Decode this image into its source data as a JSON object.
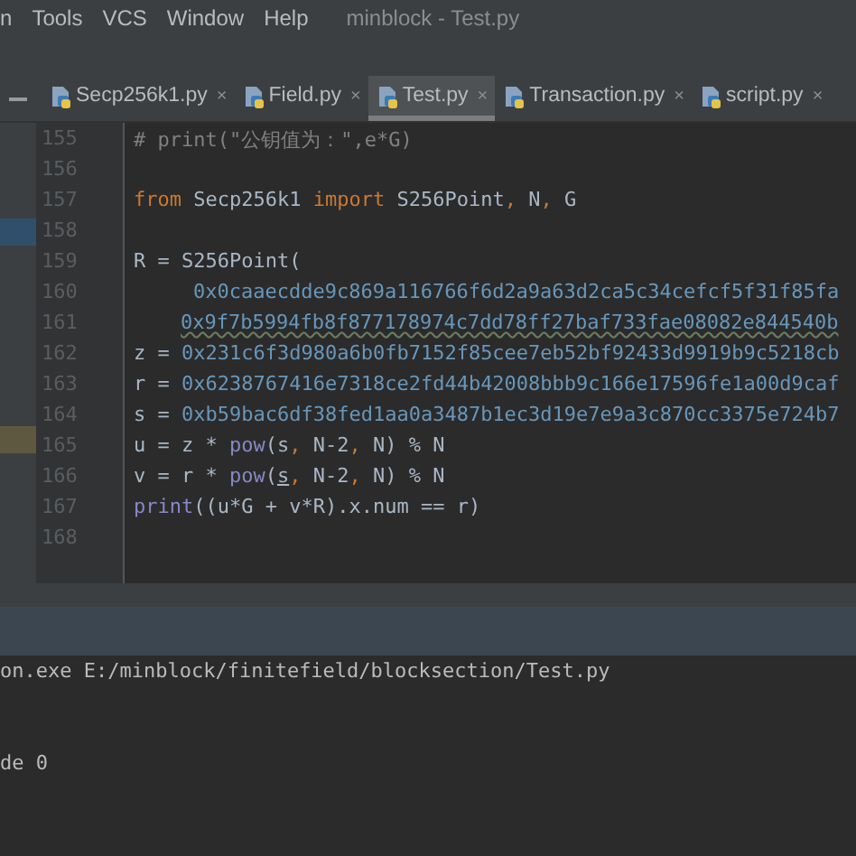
{
  "menu_bar": {
    "items": [
      "n",
      "Tools",
      "VCS",
      "Window",
      "Help"
    ],
    "title": "minblock - Test.py"
  },
  "tabs": [
    {
      "label": "Secp256k1.py",
      "close": "×",
      "selected": false
    },
    {
      "label": "Field.py",
      "close": "×",
      "selected": false
    },
    {
      "label": "Test.py",
      "close": "×",
      "selected": true
    },
    {
      "label": "Transaction.py",
      "close": "×",
      "selected": false
    },
    {
      "label": "script.py",
      "close": "×",
      "selected": false
    }
  ],
  "editor": {
    "lines": [
      {
        "number": "155",
        "tokens": [
          {
            "kind": "comment",
            "text": "# print(\"公钥值为：\",e*G)"
          }
        ]
      },
      {
        "number": "156"
      },
      {
        "number": "157",
        "tokens": [
          {
            "kind": "keyword",
            "text": "from"
          },
          {
            "kind": "plain",
            "text": " Secp256k1 "
          },
          {
            "kind": "keyword",
            "text": "import"
          },
          {
            "kind": "plain",
            "text": " S256Point"
          },
          {
            "kind": "keyword",
            "text": ","
          },
          {
            "kind": "plain",
            "text": " N"
          },
          {
            "kind": "keyword",
            "text": ","
          },
          {
            "kind": "plain",
            "text": " G"
          }
        ]
      },
      {
        "number": "158"
      },
      {
        "number": "159",
        "tokens": [
          {
            "kind": "plain",
            "text": "R = S256Point("
          }
        ]
      },
      {
        "number": "160",
        "tokens": [
          {
            "kind": "argument",
            "text": "0x0caaecdde9c869a116766f6d2a9a63d2ca5c34cefcf5f31f85fa"
          }
        ]
      },
      {
        "number": "161",
        "tokens": [
          {
            "kind": "argument-underlined",
            "text": "0x9f7b5994fb8f877178974c7dd78ff27baf733fae08082e844540b"
          }
        ]
      },
      {
        "number": "162",
        "tokens": [
          {
            "kind": "plain",
            "text": "z = "
          },
          {
            "kind": "number",
            "text": "0x231c6f3d980a6b0fb7152f85cee7eb52bf92433d9919b9c5218cb"
          }
        ]
      },
      {
        "number": "163",
        "tokens": [
          {
            "kind": "plain",
            "text": "r = "
          },
          {
            "kind": "number",
            "text": "0x6238767416e7318ce2fd44b42008bbb9c166e17596fe1a00d9caf"
          }
        ]
      },
      {
        "number": "164",
        "tokens": [
          {
            "kind": "plain",
            "text": "s = "
          },
          {
            "kind": "number",
            "text": "0xb59bac6df38fed1aa0a3487b1ec3d19e7e9a3c870cc3375e724b7"
          }
        ]
      },
      {
        "number": "165",
        "tokens": [
          {
            "kind": "plain",
            "text": "u = z * "
          },
          {
            "kind": "builtin",
            "text": "pow"
          },
          {
            "kind": "plain",
            "text": "(s"
          },
          {
            "kind": "keyword",
            "text": ","
          },
          {
            "kind": "plain",
            "text": " N-2"
          },
          {
            "kind": "keyword",
            "text": ","
          },
          {
            "kind": "plain",
            "text": " N) % N"
          }
        ]
      },
      {
        "number": "166",
        "tokens": [
          {
            "kind": "plain",
            "text": "v = r * "
          },
          {
            "kind": "builtin",
            "text": "pow"
          },
          {
            "kind": "plain",
            "text": "("
          },
          {
            "kind": "underlined",
            "text": "s"
          },
          {
            "kind": "keyword",
            "text": ","
          },
          {
            "kind": "plain",
            "text": " N-2"
          },
          {
            "kind": "keyword",
            "text": ","
          },
          {
            "kind": "plain",
            "text": " N) % N"
          }
        ]
      },
      {
        "number": "167",
        "tokens": [
          {
            "kind": "builtin",
            "text": "print"
          },
          {
            "kind": "plain",
            "text": "((u*G + v*R).x.num == r)"
          }
        ]
      },
      {
        "number": "168"
      }
    ]
  },
  "console": {
    "lines": [
      "on.exe E:/minblock/finitefield/blocksection/Test.py",
      "de 0"
    ]
  }
}
